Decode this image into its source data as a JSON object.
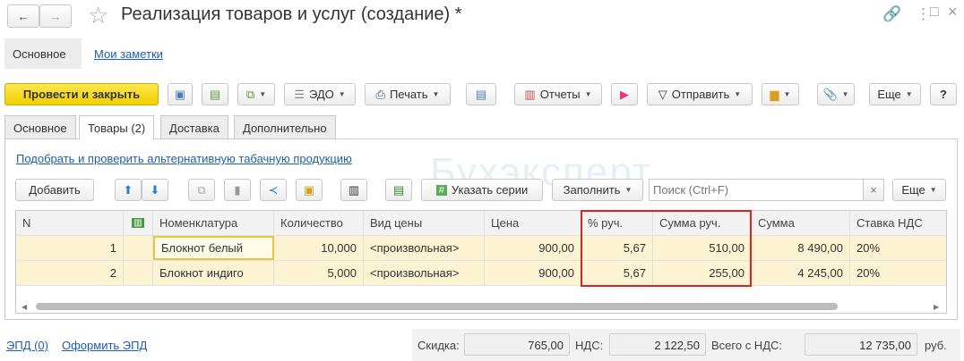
{
  "title": "Реализация товаров и услуг (создание) *",
  "nav_tabs": [
    "Основное",
    "Мои заметки"
  ],
  "toolbar": {
    "post_close": "Провести и закрыть",
    "edo": "ЭДО",
    "print": "Печать",
    "reports": "Отчеты",
    "send": "Отправить",
    "more": "Еще",
    "help": "?"
  },
  "tabs": [
    "Основное",
    "Товары (2)",
    "Доставка",
    "Дополнительно"
  ],
  "tobacco_link": "Подобрать и проверить альтернативную табачную продукцию",
  "table_toolbar": {
    "add": "Добавить",
    "series": "Указать серии",
    "fill": "Заполнить",
    "search_placeholder": "Поиск (Ctrl+F)",
    "clear": "×",
    "more": "Еще"
  },
  "columns": [
    "N",
    "",
    "Номенклатура",
    "Количество",
    "Вид цены",
    "Цена",
    "% руч.",
    "Сумма руч.",
    "Сумма",
    "Ставка НДС"
  ],
  "rows": [
    [
      "1",
      "",
      "Блокнот белый",
      "10,000",
      "<произвольная>",
      "900,00",
      "5,67",
      "510,00",
      "8 490,00",
      "20%"
    ],
    [
      "2",
      "",
      "Блокнот индиго",
      "5,000",
      "<произвольная>",
      "900,00",
      "5,67",
      "255,00",
      "4 245,00",
      "20%"
    ]
  ],
  "footer": {
    "epd": "ЭПД (0)",
    "make_epd": "Оформить ЭПД",
    "discount_label": "Скидка:",
    "discount": "765,00",
    "vat_label": "НДС:",
    "vat": "2 122,50",
    "total_label": "Всего с НДС:",
    "total": "12 735,00",
    "currency": "руб."
  },
  "watermark": "Бухэксперт",
  "colors": {
    "accent": "#f5d800",
    "highlight": "#e02020",
    "row": "#fbf3d2"
  }
}
